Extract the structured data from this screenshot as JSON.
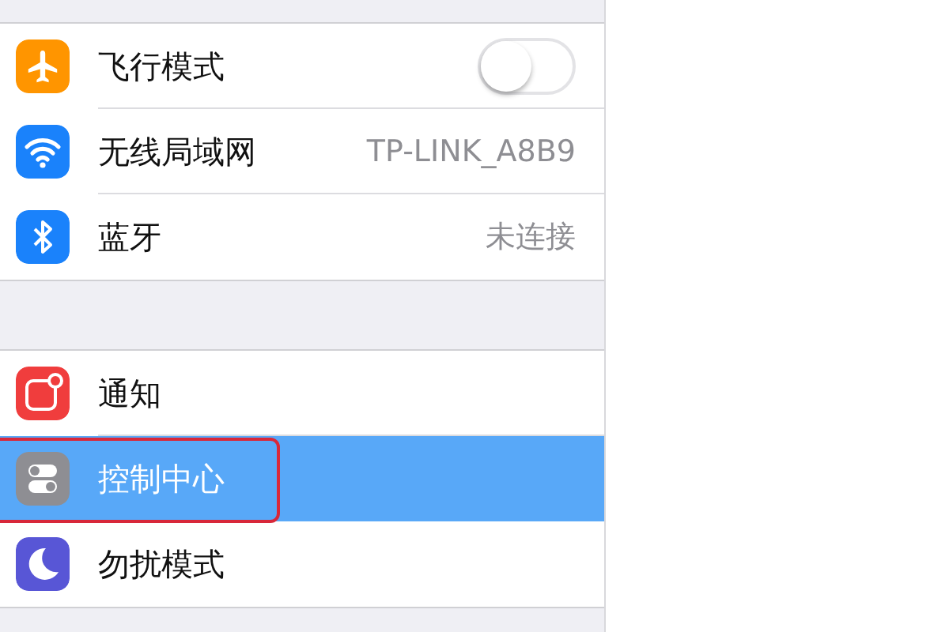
{
  "groups": [
    {
      "items": [
        {
          "kind": "toggle",
          "label": "飞行模式",
          "on": false,
          "selected": false,
          "highlighted": false
        },
        {
          "kind": "value",
          "label": "无线局域网",
          "value": "TP-LINK_A8B9",
          "selected": false,
          "highlighted": false
        },
        {
          "kind": "value",
          "label": "蓝牙",
          "value": "未连接",
          "selected": false,
          "highlighted": false
        }
      ]
    },
    {
      "items": [
        {
          "kind": "plain",
          "label": "通知",
          "selected": false,
          "highlighted": false
        },
        {
          "kind": "plain",
          "label": "控制中心",
          "selected": true,
          "highlighted": true
        },
        {
          "kind": "plain",
          "label": "勿扰模式",
          "selected": false,
          "highlighted": false
        }
      ]
    }
  ]
}
